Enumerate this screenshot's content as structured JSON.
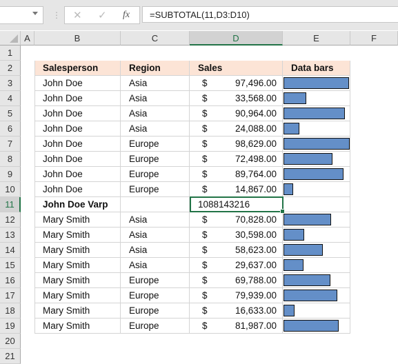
{
  "formula_bar": {
    "name_box": "",
    "cancel_icon": "✕",
    "enter_icon": "✓",
    "fx_label": "fx",
    "formula": "=SUBTOTAL(11,D3:D10)"
  },
  "columns": [
    "A",
    "B",
    "C",
    "D",
    "E",
    "F"
  ],
  "selected_column": "D",
  "rows": [
    "1",
    "2",
    "3",
    "4",
    "5",
    "6",
    "7",
    "8",
    "9",
    "10",
    "11",
    "12",
    "13",
    "14",
    "15",
    "16",
    "17",
    "18",
    "19",
    "20",
    "21"
  ],
  "selected_row": "11",
  "table": {
    "headers": [
      "Salesperson",
      "Region",
      "Sales",
      "Data bars"
    ],
    "currency_symbol": "$",
    "bar_color": "#648fc8",
    "bar_max": 98629,
    "group1": [
      {
        "salesperson": "John Doe",
        "region": "Asia",
        "sales": "97,496.00",
        "value": 97496
      },
      {
        "salesperson": "John Doe",
        "region": "Asia",
        "sales": "33,568.00",
        "value": 33568
      },
      {
        "salesperson": "John Doe",
        "region": "Asia",
        "sales": "90,964.00",
        "value": 90964
      },
      {
        "salesperson": "John Doe",
        "region": "Asia",
        "sales": "24,088.00",
        "value": 24088
      },
      {
        "salesperson": "John Doe",
        "region": "Europe",
        "sales": "98,629.00",
        "value": 98629
      },
      {
        "salesperson": "John Doe",
        "region": "Europe",
        "sales": "72,498.00",
        "value": 72498
      },
      {
        "salesperson": "John Doe",
        "region": "Europe",
        "sales": "89,764.00",
        "value": 89764
      },
      {
        "salesperson": "John Doe",
        "region": "Europe",
        "sales": "14,867.00",
        "value": 14867
      }
    ],
    "subtotal": {
      "label": "John Doe Varp",
      "value": "1088143216"
    },
    "group2": [
      {
        "salesperson": "Mary Smith",
        "region": "Asia",
        "sales": "70,828.00",
        "value": 70828
      },
      {
        "salesperson": "Mary Smith",
        "region": "Asia",
        "sales": "30,598.00",
        "value": 30598
      },
      {
        "salesperson": "Mary Smith",
        "region": "Asia",
        "sales": "58,623.00",
        "value": 58623
      },
      {
        "salesperson": "Mary Smith",
        "region": "Asia",
        "sales": "29,637.00",
        "value": 29637
      },
      {
        "salesperson": "Mary Smith",
        "region": "Europe",
        "sales": "69,788.00",
        "value": 69788
      },
      {
        "salesperson": "Mary Smith",
        "region": "Europe",
        "sales": "79,939.00",
        "value": 79939
      },
      {
        "salesperson": "Mary Smith",
        "region": "Europe",
        "sales": "16,633.00",
        "value": 16633
      },
      {
        "salesperson": "Mary Smith",
        "region": "Europe",
        "sales": "81,987.00",
        "value": 81987
      }
    ]
  }
}
